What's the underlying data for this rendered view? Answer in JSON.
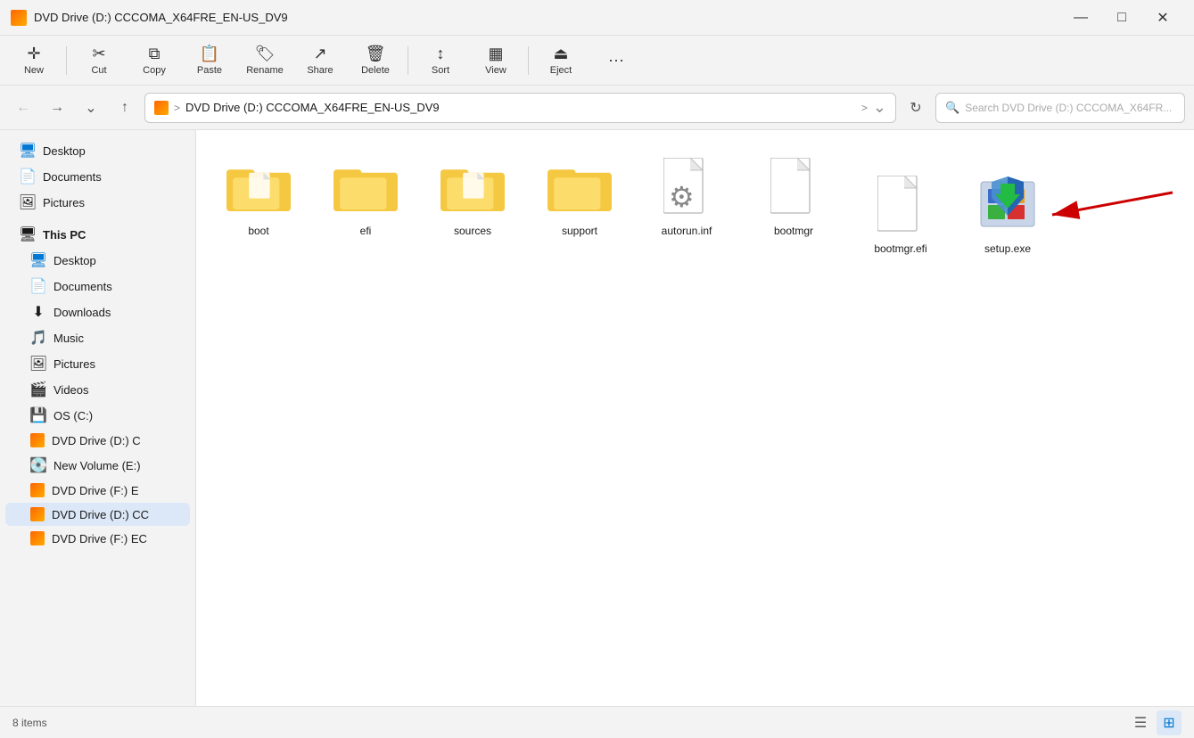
{
  "titleBar": {
    "icon": "dvd-drive-icon",
    "title": "DVD Drive (D:) CCCOMA_X64FRE_EN-US_DV9",
    "minimize": "—",
    "maximize": "□",
    "close": "✕"
  },
  "toolbar": {
    "new_label": "New",
    "cut_label": "Cut",
    "copy_label": "Copy",
    "paste_label": "Paste",
    "rename_label": "Rename",
    "share_label": "Share",
    "delete_label": "Delete",
    "sort_label": "Sort",
    "view_label": "View",
    "eject_label": "Eject",
    "more_label": "···"
  },
  "addressBar": {
    "back_title": "Back",
    "forward_title": "Forward",
    "recent_title": "Recent",
    "up_title": "Up",
    "path_icon": "dvd-drive",
    "path_separator1": ">",
    "path_text": "DVD Drive (D:) CCCOMA_X64FRE_EN-US_DV9",
    "path_separator2": ">",
    "refresh_title": "Refresh",
    "search_placeholder": "Search DVD Drive (D:) CCCOMA_X64FR..."
  },
  "sidebar": {
    "pinned": [
      {
        "id": "desktop-pinned",
        "label": "Desktop",
        "icon": "desktop"
      },
      {
        "id": "documents-pinned",
        "label": "Documents",
        "icon": "documents"
      },
      {
        "id": "pictures-pinned",
        "label": "Pictures",
        "icon": "pictures"
      }
    ],
    "thisPC": {
      "label": "This PC",
      "items": [
        {
          "id": "desktop-pc",
          "label": "Desktop",
          "icon": "desktop"
        },
        {
          "id": "documents-pc",
          "label": "Documents",
          "icon": "documents"
        },
        {
          "id": "downloads-pc",
          "label": "Downloads",
          "icon": "downloads"
        },
        {
          "id": "music-pc",
          "label": "Music",
          "icon": "music"
        },
        {
          "id": "pictures-pc",
          "label": "Pictures",
          "icon": "pictures"
        },
        {
          "id": "videos-pc",
          "label": "Videos",
          "icon": "videos"
        },
        {
          "id": "os-c",
          "label": "OS (C:)",
          "icon": "drive"
        },
        {
          "id": "dvd-d",
          "label": "DVD Drive (D:) C",
          "icon": "dvd"
        },
        {
          "id": "new-vol-e",
          "label": "New Volume (E:)",
          "icon": "drive2"
        },
        {
          "id": "dvd-f",
          "label": "DVD Drive (F:) E",
          "icon": "dvd"
        },
        {
          "id": "dvd-d-active",
          "label": "DVD Drive (D:) CC",
          "icon": "dvd"
        },
        {
          "id": "dvd-f2",
          "label": "DVD Drive (F:) EC",
          "icon": "dvd"
        }
      ]
    }
  },
  "files": [
    {
      "id": "boot",
      "name": "boot",
      "type": "folder-with-doc"
    },
    {
      "id": "efi",
      "name": "efi",
      "type": "folder-plain"
    },
    {
      "id": "sources",
      "name": "sources",
      "type": "folder-with-doc"
    },
    {
      "id": "support",
      "name": "support",
      "type": "folder-plain"
    },
    {
      "id": "autorun",
      "name": "autorun.inf",
      "type": "gear-file"
    },
    {
      "id": "bootmgr",
      "name": "bootmgr",
      "type": "generic-file"
    },
    {
      "id": "bootmgr-efi",
      "name": "bootmgr.efi",
      "type": "generic-file"
    },
    {
      "id": "setup",
      "name": "setup.exe",
      "type": "setup-exe"
    }
  ],
  "statusBar": {
    "count": "8 items",
    "list_view_title": "List view",
    "grid_view_title": "Grid view"
  }
}
